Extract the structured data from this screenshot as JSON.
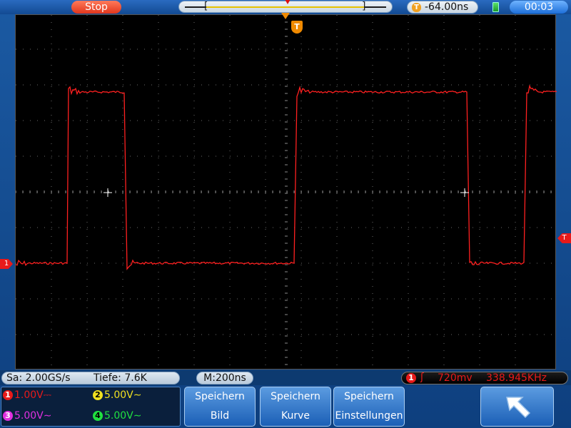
{
  "topbar": {
    "run_status": "Stop",
    "overview_left_bracket": "[",
    "overview_right_bracket": "]",
    "trigger_offset": "-64.00ns",
    "clock": "00:03"
  },
  "screen": {
    "trigger_pos_marker": "T",
    "ch1_marker": "1",
    "trigger_level_marker": "T",
    "waveform_color": "#ff2020"
  },
  "infobar": {
    "sample_rate": "Sa: 2.00GS/s",
    "depth": "Tiefe: 7.6K",
    "timebase": "M:200ns",
    "trigger_channel": "1",
    "trigger_edge": "ʃ",
    "trigger_level": "720mv",
    "trigger_freq": "338.945KHz"
  },
  "channels": [
    {
      "num": "1",
      "scale": "1.00V⎓",
      "color": "#e81a1a"
    },
    {
      "num": "2",
      "scale": "5.00V∼",
      "color": "#f0e020"
    },
    {
      "num": "3",
      "scale": "5.00V∼",
      "color": "#e030e0"
    },
    {
      "num": "4",
      "scale": "5.00V∼",
      "color": "#20e040"
    }
  ],
  "softkeys": [
    {
      "line1": "Speichern",
      "line2": "Bild"
    },
    {
      "line1": "Speichern",
      "line2": "Kurve"
    },
    {
      "line1": "Speichern",
      "line2": "Einstellungen"
    }
  ],
  "back_icon": "back-arrow-icon"
}
